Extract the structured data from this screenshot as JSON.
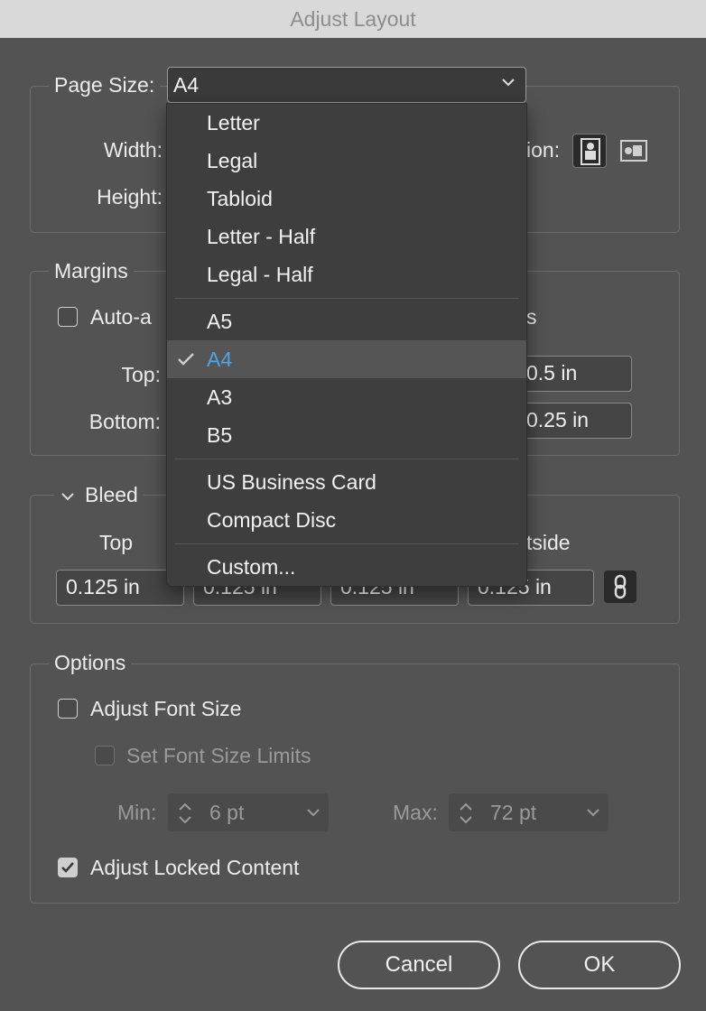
{
  "window": {
    "title": "Adjust Layout"
  },
  "page_size": {
    "label": "Page Size:",
    "value": "A4",
    "width_label": "Width:",
    "height_label": "Height:",
    "orientation_label_fragment": "ion:"
  },
  "dropdown": {
    "groups": [
      [
        "Letter",
        "Legal",
        "Tabloid",
        "Letter - Half",
        "Legal - Half"
      ],
      [
        "A5",
        "A4",
        "A3",
        "B5"
      ],
      [
        "US Business Card",
        "Compact Disc"
      ],
      [
        "Custom..."
      ]
    ],
    "selected": "A4"
  },
  "margins": {
    "legend": "Margins",
    "auto_fragment": "Auto-a",
    "right_fragment": "s",
    "top_label": "Top:",
    "bottom_label": "Bottom:",
    "right_top_value": "0.5 in",
    "right_bottom_value": "0.25 in"
  },
  "bleed": {
    "legend": "Bleed",
    "col1": "Top",
    "col4_fragment": "tside",
    "values": [
      "0.125 in",
      "0.125 in",
      "0.125 in",
      "0.125 in"
    ]
  },
  "options": {
    "legend": "Options",
    "adjust_font": "Adjust Font Size",
    "set_limits": "Set Font Size Limits",
    "min_label": "Min:",
    "min_value": "6 pt",
    "max_label": "Max:",
    "max_value": "72 pt",
    "adjust_locked": "Adjust Locked Content",
    "adjust_locked_checked": true
  },
  "buttons": {
    "cancel": "Cancel",
    "ok": "OK"
  },
  "colors": {
    "accent": "#4fa3ea",
    "dialog_bg": "#535353",
    "menu_bg": "#3e3e3e"
  }
}
